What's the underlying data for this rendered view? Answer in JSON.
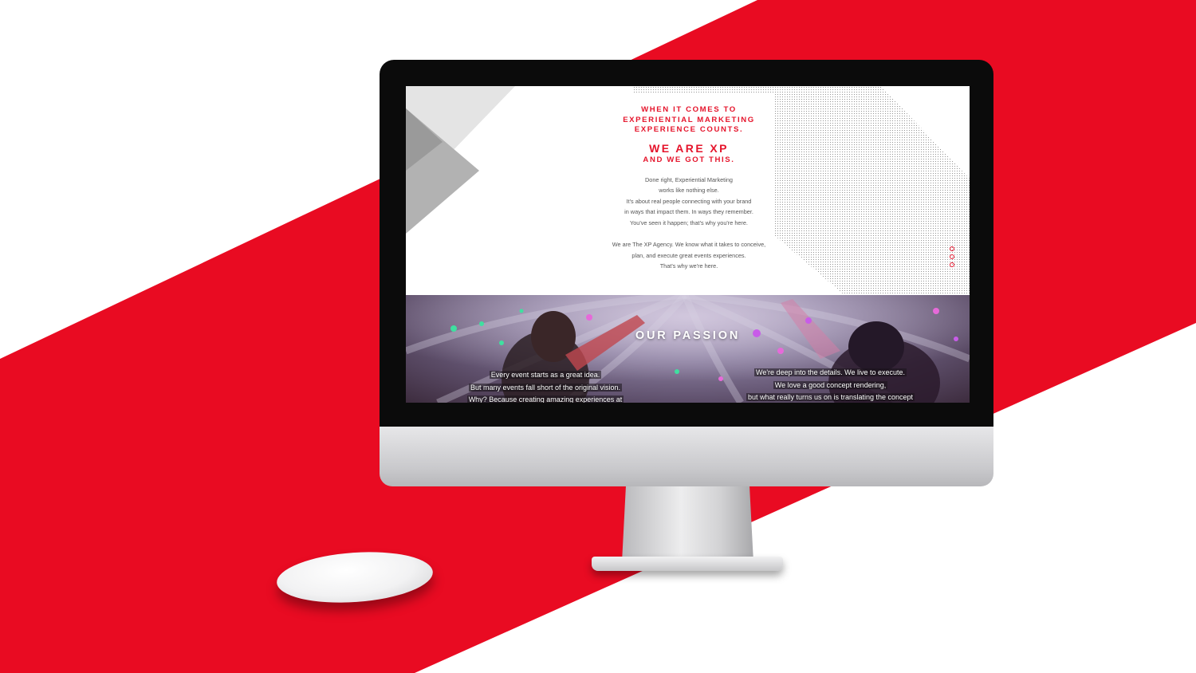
{
  "colors": {
    "brand_red": "#e5142b",
    "band_red": "#e90b22",
    "background_white": "#ffffff",
    "bezel_black": "#0b0b0b"
  },
  "hero": {
    "intro_lines": [
      "WHEN IT COMES TO",
      "EXPERIENTIAL MARKETING",
      "EXPERIENCE COUNTS."
    ],
    "brand_heading": "WE ARE XP",
    "brand_subheading": "AND WE GOT THIS.",
    "paragraph_1": [
      "Done right, Experiential Marketing",
      "works like nothing else.",
      "It's about real people connecting with your brand",
      "in ways that impact them. In ways they remember.",
      "You've seen it happen; that's why you're here."
    ],
    "paragraph_2": [
      "We are The XP Agency. We know what it takes to conceive,",
      "plan, and execute great events experiences.",
      "That's why we're here."
    ]
  },
  "section_nav": {
    "dot_count": 3,
    "icon": "circle-dot-icon"
  },
  "passion": {
    "title": "OUR PASSION",
    "left_caption": [
      "Every event starts as a great idea.",
      "But many events fall short of the original vision.",
      "Why? Because creating amazing experiences at"
    ],
    "right_caption": [
      "We're deep into the details.  We live to execute.",
      "We love a good concept rendering,",
      "but what really turns us on is translating the concept"
    ]
  }
}
